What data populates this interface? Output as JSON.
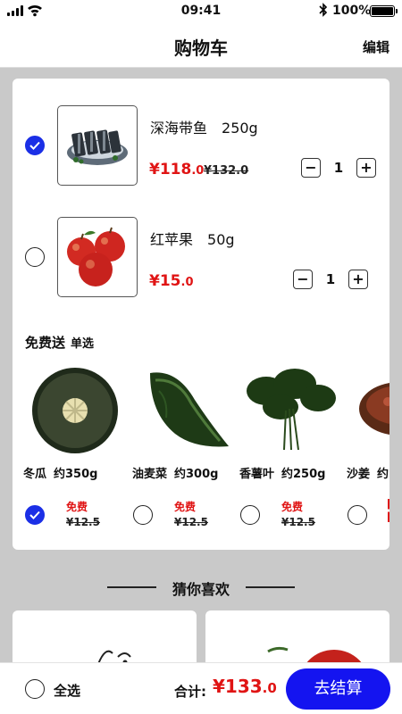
{
  "status_bar": {
    "time": "09:41",
    "battery": "100%"
  },
  "header": {
    "title": "购物车",
    "edit_label": "编辑"
  },
  "cart": {
    "items": [
      {
        "name": "深海带鱼",
        "weight": "250g",
        "price": "¥118",
        "price_decimal": ".0",
        "original_price": "¥132.0",
        "quantity": "1",
        "checked": true,
        "icon": "ribbonfish-image"
      },
      {
        "name": "红苹果",
        "weight": "50g",
        "price": "¥15",
        "price_decimal": ".0",
        "original_price": "",
        "quantity": "1",
        "checked": false,
        "icon": "red-apple-image"
      }
    ],
    "minus_label": "−",
    "plus_label": "+"
  },
  "gifts": {
    "title": "免费送",
    "subtitle": "单选",
    "items": [
      {
        "name": "冬瓜",
        "weight": "约350g",
        "free_label": "免费",
        "original_price": "¥12.5",
        "checked": true,
        "icon": "winter-melon-image"
      },
      {
        "name": "油麦菜",
        "weight": "约300g",
        "free_label": "免费",
        "original_price": "¥12.5",
        "checked": false,
        "icon": "lettuce-image"
      },
      {
        "name": "香薯叶",
        "weight": "约250g",
        "free_label": "免费",
        "original_price": "¥12.5",
        "checked": false,
        "icon": "sweet-potato-leaf-image"
      },
      {
        "name": "沙姜",
        "weight": "约",
        "free_label": "",
        "original_price": "",
        "checked": false,
        "icon": "sand-ginger-image"
      }
    ]
  },
  "recommend": {
    "title": "猜你喜欢"
  },
  "footer": {
    "select_all_label": "全选",
    "total_label": "合计:",
    "total_value": "¥133",
    "total_decimal": ".0",
    "checkout_label": "去结算"
  },
  "colors": {
    "accent": "#1b2fe6",
    "price": "#e01414",
    "checkout": "#1414f0",
    "background": "#c9c9c9"
  }
}
